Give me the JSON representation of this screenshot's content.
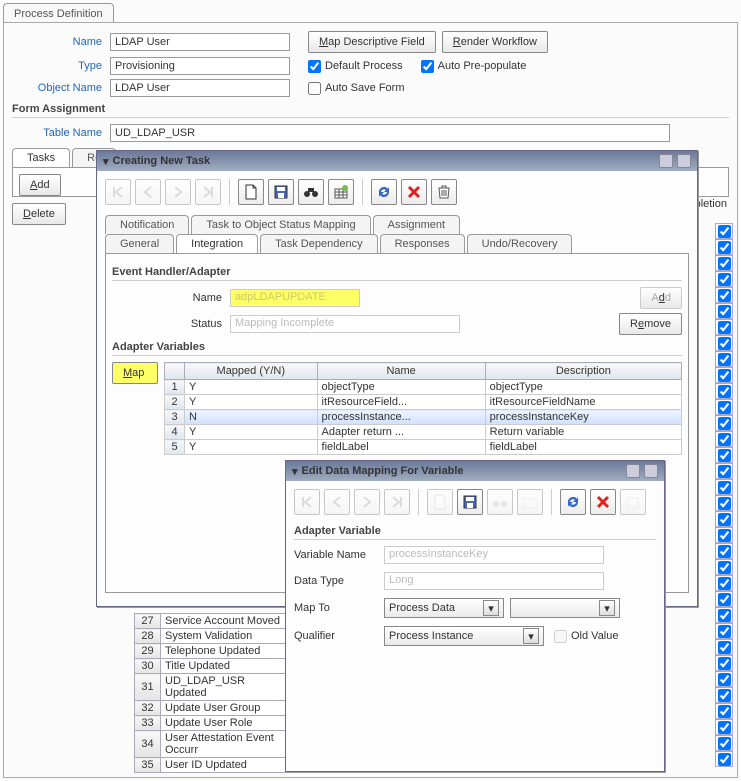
{
  "panelTab": "Process Definition",
  "labels": {
    "name": "Name",
    "type": "Type",
    "objectName": "Object Name",
    "tableName": "Table Name"
  },
  "fields": {
    "name": "LDAP User",
    "type": "Provisioning",
    "objectName": "LDAP User",
    "tableName": "UD_LDAP_USR"
  },
  "topButtons": {
    "mapDesc": "Map Descriptive Field",
    "renderWf": "Render Workflow"
  },
  "checks": {
    "defaultProcess": "Default Process",
    "autoPrepop": "Auto Pre-populate",
    "autoSave": "Auto Save Form"
  },
  "formAssignment": "Form Assignment",
  "mainTabs": {
    "tasks": "Tasks",
    "re": "Re"
  },
  "sideButtons": {
    "add": "Add",
    "delete": "Delete"
  },
  "forCompletion": "for Completion",
  "modal1": {
    "title": "Creating New Task",
    "tabRow1": {
      "notif": "Notification",
      "t2o": "Task to Object Status Mapping",
      "assign": "Assignment"
    },
    "tabRow2": {
      "general": "General",
      "integ": "Integration",
      "taskdep": "Task Dependency",
      "resp": "Responses",
      "undo": "Undo/Recovery"
    },
    "ehHeader": "Event Handler/Adapter",
    "ehName": "Name",
    "ehNameVal": "adpLDAPUPDATE",
    "ehStatus": "Status",
    "ehStatusVal": "Mapping Incomplete",
    "ehAdd": "Add",
    "ehRemove": "Remove",
    "avHeader": "Adapter Variables",
    "mapBtn": "Map",
    "cols": {
      "yn": "Mapped (Y/N)",
      "name": "Name",
      "desc": "Description"
    },
    "rows": [
      {
        "n": "1",
        "yn": "Y",
        "name": "objectType",
        "desc": "objectType"
      },
      {
        "n": "2",
        "yn": "Y",
        "name": "itResourceField...",
        "desc": "itResourceFieldName"
      },
      {
        "n": "3",
        "yn": "N",
        "name": "processInstance...",
        "desc": "processInstanceKey"
      },
      {
        "n": "4",
        "yn": "Y",
        "name": "Adapter return ...",
        "desc": "Return variable"
      },
      {
        "n": "5",
        "yn": "Y",
        "name": "fieldLabel",
        "desc": "fieldLabel"
      }
    ]
  },
  "modal2": {
    "title": "Edit Data Mapping For Variable",
    "header": "Adapter Variable",
    "varName": "Variable Name",
    "varNameVal": "processInstanceKey",
    "dataType": "Data Type",
    "dataTypeVal": "Long",
    "mapTo": "Map To",
    "mapToVal": "Process Data",
    "qualifier": "Qualifier",
    "qualifierVal": "Process Instance",
    "oldValue": "Old Value"
  },
  "bgTasks": [
    {
      "n": "27",
      "t": "Service Account Moved"
    },
    {
      "n": "28",
      "t": "System Validation"
    },
    {
      "n": "29",
      "t": "Telephone Updated"
    },
    {
      "n": "30",
      "t": "Title Updated"
    },
    {
      "n": "31",
      "t": "UD_LDAP_USR Updated"
    },
    {
      "n": "32",
      "t": "Update User Group"
    },
    {
      "n": "33",
      "t": "Update User Role"
    },
    {
      "n": "34",
      "t": "User Attestation Event Occurr"
    },
    {
      "n": "35",
      "t": "User ID Updated"
    }
  ]
}
